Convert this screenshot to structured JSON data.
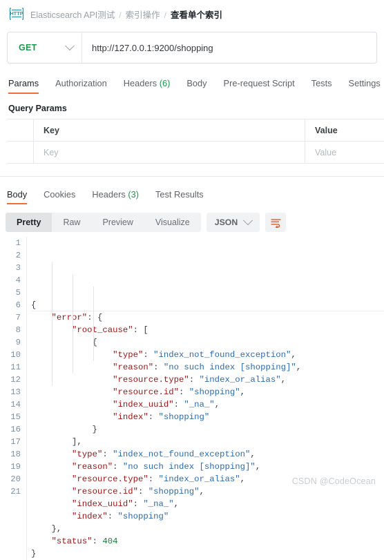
{
  "breadcrumb": {
    "icon": "http-protocol-icon",
    "collection": "Elasticsearch API测试",
    "sep1": "/",
    "folder": "索引操作",
    "sep2": "/",
    "request": "查看单个索引"
  },
  "url_bar": {
    "method": "GET",
    "method_color": "#1a9b4b",
    "url": "http://127.0.0.1:9200/shopping"
  },
  "request_tabs": [
    {
      "label": "Params",
      "active": true,
      "count": ""
    },
    {
      "label": "Authorization",
      "active": false,
      "count": ""
    },
    {
      "label": "Headers",
      "active": false,
      "count": "(6)"
    },
    {
      "label": "Body",
      "active": false,
      "count": ""
    },
    {
      "label": "Pre-request Script",
      "active": false,
      "count": ""
    },
    {
      "label": "Tests",
      "active": false,
      "count": ""
    },
    {
      "label": "Settings",
      "active": false,
      "count": ""
    }
  ],
  "query_params": {
    "title": "Query Params",
    "headers": {
      "key": "Key",
      "value": "Value"
    },
    "rows": [
      {
        "key_placeholder": "Key",
        "value_placeholder": "Value"
      }
    ]
  },
  "response_tabs": [
    {
      "label": "Body",
      "active": true,
      "count": ""
    },
    {
      "label": "Cookies",
      "active": false,
      "count": ""
    },
    {
      "label": "Headers",
      "active": false,
      "count": "(3)"
    },
    {
      "label": "Test Results",
      "active": false,
      "count": ""
    }
  ],
  "view_bar": {
    "segments": [
      {
        "label": "Pretty",
        "active": true
      },
      {
        "label": "Raw",
        "active": false
      },
      {
        "label": "Preview",
        "active": false
      },
      {
        "label": "Visualize",
        "active": false
      }
    ],
    "format": "JSON",
    "wrap_icon": "text-wrap-icon",
    "accent_color": "#f26b3a"
  },
  "response_body": {
    "language": "json",
    "lines": [
      {
        "n": 1,
        "text": "{"
      },
      {
        "n": 2,
        "text": "    \"error\": {"
      },
      {
        "n": 3,
        "text": "        \"root_cause\": ["
      },
      {
        "n": 4,
        "text": "            {"
      },
      {
        "n": 5,
        "text": "                \"type\": \"index_not_found_exception\","
      },
      {
        "n": 6,
        "text": "                \"reason\": \"no such index [shopping]\","
      },
      {
        "n": 7,
        "text": "                \"resource.type\": \"index_or_alias\","
      },
      {
        "n": 8,
        "text": "                \"resource.id\": \"shopping\","
      },
      {
        "n": 9,
        "text": "                \"index_uuid\": \"_na_\","
      },
      {
        "n": 10,
        "text": "                \"index\": \"shopping\""
      },
      {
        "n": 11,
        "text": "            }"
      },
      {
        "n": 12,
        "text": "        ],"
      },
      {
        "n": 13,
        "text": "        \"type\": \"index_not_found_exception\","
      },
      {
        "n": 14,
        "text": "        \"reason\": \"no such index [shopping]\","
      },
      {
        "n": 15,
        "text": "        \"resource.type\": \"index_or_alias\","
      },
      {
        "n": 16,
        "text": "        \"resource.id\": \"shopping\","
      },
      {
        "n": 17,
        "text": "        \"index_uuid\": \"_na_\","
      },
      {
        "n": 18,
        "text": "        \"index\": \"shopping\""
      },
      {
        "n": 19,
        "text": "    },"
      },
      {
        "n": 20,
        "text": "    \"status\": 404"
      },
      {
        "n": 21,
        "text": "}"
      }
    ]
  },
  "watermark": "CSDN @CodeOcean"
}
